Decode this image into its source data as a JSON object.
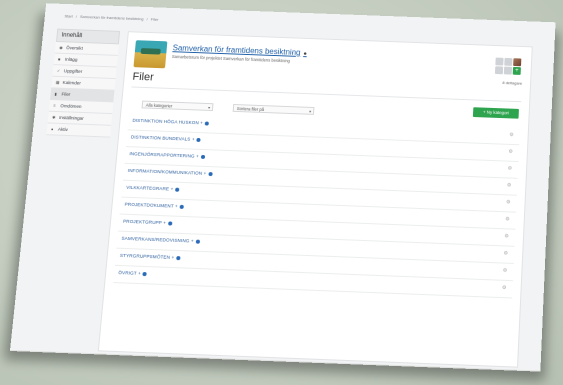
{
  "breadcrumb": [
    "Start",
    "/",
    "Samverkan för framtidens besiktning",
    "/",
    "Filer"
  ],
  "sidebar": {
    "title": "Innehåll",
    "items": [
      {
        "label": "Översikt",
        "icon": "eye-icon"
      },
      {
        "label": "Inlägg",
        "icon": "comment-icon"
      },
      {
        "label": "Uppgifter",
        "icon": "check-icon"
      },
      {
        "label": "Kalender",
        "icon": "calendar-icon"
      },
      {
        "label": "Filer",
        "icon": "file-icon"
      },
      {
        "label": "Omdömen",
        "icon": "list-icon"
      },
      {
        "label": "Inställningar",
        "icon": "gear-icon"
      },
      {
        "label": "Aktiv",
        "icon": "user-icon"
      }
    ]
  },
  "course": {
    "title": "Samverkan för framtidens besiktning",
    "subtitle": "Samarbetsrum för projektet Samverkan för framtidens besiktning",
    "members_label": "8 deltagare"
  },
  "page": {
    "title": "Filer",
    "new_category_label": "+ Ny kategori",
    "filter_category": "Alla kategorier",
    "sort_label": "Sortera filer på"
  },
  "categories": [
    "DISTINKTION HÖGA HUSKON",
    "DISTINKTION BUNDEVALS",
    "INGENJÖRSRAPPORTERING",
    "INFORMATION/KOMMUNIKATION",
    "VILKKARTEGRARE",
    "PROJEKTDOKUMENT",
    "PROJEKTGRUPP",
    "SAMVERKANS/REDOVISNING",
    "STYRGRUPPSMÖTEN",
    "ÖVRIGT"
  ],
  "colors": {
    "accent": "#2fa44f",
    "link": "#1f5fa8"
  }
}
